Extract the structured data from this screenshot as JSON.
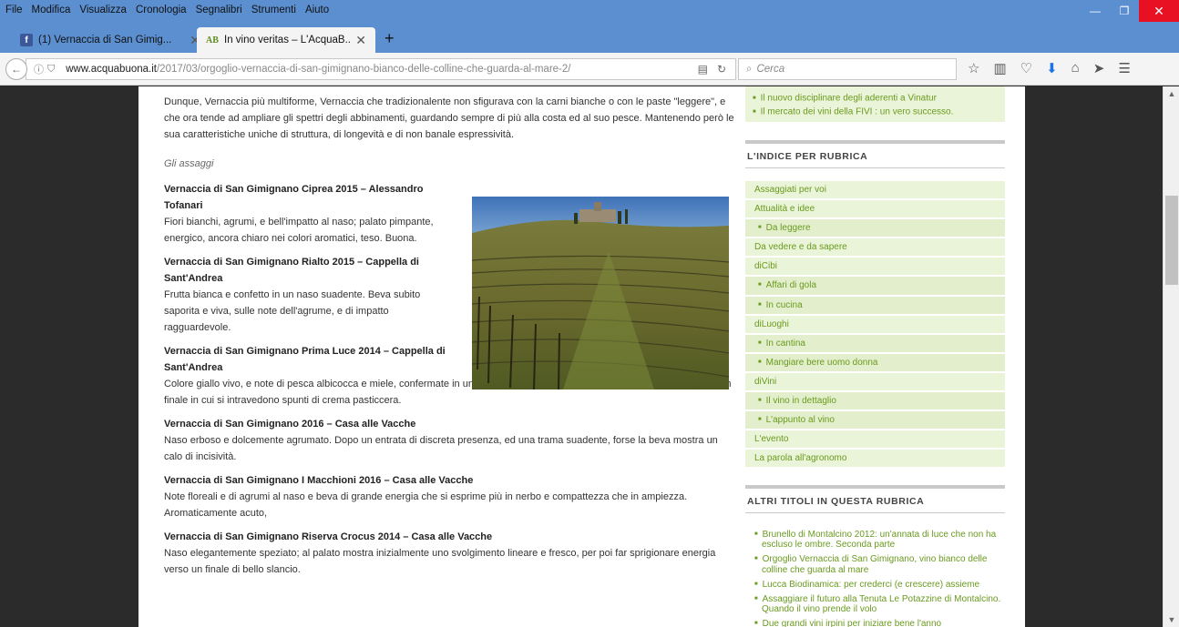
{
  "menu": [
    "File",
    "Modifica",
    "Visualizza",
    "Cronologia",
    "Segnalibri",
    "Strumenti",
    "Aiuto"
  ],
  "tabs": [
    {
      "title": "(1) Vernaccia di San Gimig...",
      "icon": "facebook-icon",
      "active": false
    },
    {
      "title": "In vino veritas – L'AcquaB...",
      "icon": "acquabuona-icon",
      "active": true
    }
  ],
  "url": {
    "host": "www.acquabuona.it",
    "path": "/2017/03/orgoglio-vernaccia-di-san-gimignano-bianco-delle-colline-che-guarda-al-mare-2/"
  },
  "search": {
    "placeholder": "Cerca"
  },
  "article": {
    "intro": "Dunque, Vernaccia più multiforme, Vernaccia che tradizionalente non sfigurava con la carni bianche o con le paste \"leggere\", e che ora tende ad ampliare gli spettri degli abbinamenti, guardando sempre di più alla costa ed al suo pesce. Mantenendo però le sua caratteristiche uniche di struttura, di longevità e di non banale espressività.",
    "subhead": "Gli assaggi",
    "wines": [
      {
        "title": "Vernaccia di San Gimignano Ciprea 2015 – Alessandro Tofanari",
        "desc": "Fiori bianchi, agrumi, e bell'impatto al naso; palato pimpante, energico, ancora chiaro nei colori aromatici, teso. Buona."
      },
      {
        "title": "Vernaccia di San Gimignano Rialto 2015 – Cappella di Sant'Andrea",
        "desc": "Frutta bianca e confetto in un naso suadente. Beva subito saporita e viva, sulle note dell'agrume, e di impatto ragguardevole."
      },
      {
        "title": "Vernaccia di San Gimignano Prima Luce 2014 – Cappella di Sant'Andrea",
        "desc": "Colore giallo vivo, e note di pesca albicocca e miele, confermate in una beva in cui al velluto si aggiungono belle vibrazioni in un finale in cui si intravedono spunti di crema pasticcera."
      },
      {
        "title": "Vernaccia di San Gimignano 2016 – Casa alle Vacche",
        "desc": "Naso erboso e dolcemente agrumato. Dopo un entrata di discreta presenza, ed una trama suadente, forse la beva mostra un calo di incisività."
      },
      {
        "title": "Vernaccia di San Gimignano I Macchioni 2016 – Casa alle Vacche",
        "desc": "Note floreali e di agrumi al naso e beva di grande energia che si  esprime più in nerbo e compattezza che in ampiezza. Aromaticamente acuto,"
      },
      {
        "title": "Vernaccia di San Gimignano Riserva Crocus 2014 – Casa alle Vacche",
        "desc": "Naso elegantemente speziato; al palato mostra inizialmente uno svolgimento lineare e fresco, per poi far sprigionare energia verso un finale di bello slancio."
      }
    ]
  },
  "sidebar": {
    "top_links": [
      "Il nuovo disciplinare degli aderenti a Vinatur",
      "Il mercato dei vini della FIVI : un vero successo."
    ],
    "indice_title": "L'INDICE PER RUBRICA",
    "indice": [
      {
        "label": "Assaggiati per voi",
        "sub": false
      },
      {
        "label": "Attualità e idee",
        "sub": false
      },
      {
        "label": "Da leggere",
        "sub": true
      },
      {
        "label": "Da vedere e da sapere",
        "sub": false
      },
      {
        "label": "diCibi",
        "sub": false
      },
      {
        "label": "Affari di gola",
        "sub": true
      },
      {
        "label": "In cucina",
        "sub": true
      },
      {
        "label": "diLuoghi",
        "sub": false
      },
      {
        "label": "In cantina",
        "sub": true
      },
      {
        "label": "Mangiare bere uomo donna",
        "sub": true
      },
      {
        "label": "diVini",
        "sub": false
      },
      {
        "label": "Il vino in dettaglio",
        "sub": true
      },
      {
        "label": "L'appunto al vino",
        "sub": true
      },
      {
        "label": "L'evento",
        "sub": false
      },
      {
        "label": "La parola all'agronomo",
        "sub": false
      }
    ],
    "altri_title": "ALTRI TITOLI IN QUESTA RUBRICA",
    "altri": [
      "Brunello di Montalcino 2012: un'annata di luce che non ha escluso le ombre. Seconda parte",
      "Orgoglio Vernaccia di San Gimignano, vino bianco delle colline che guarda al mare",
      "Lucca Biodinamica: per crederci (e crescere) assieme",
      "Assaggiare il futuro alla Tenuta Le Potazzine di Montalcino. Quando il vino prende il volo",
      "Due grandi vini irpini per iniziare bene l'anno"
    ]
  },
  "colors": {
    "titlebar": "#5b8fd0",
    "link_green": "#6a9a1f",
    "sidebar_bg": "#eaf4d8",
    "close_red": "#e81123"
  }
}
